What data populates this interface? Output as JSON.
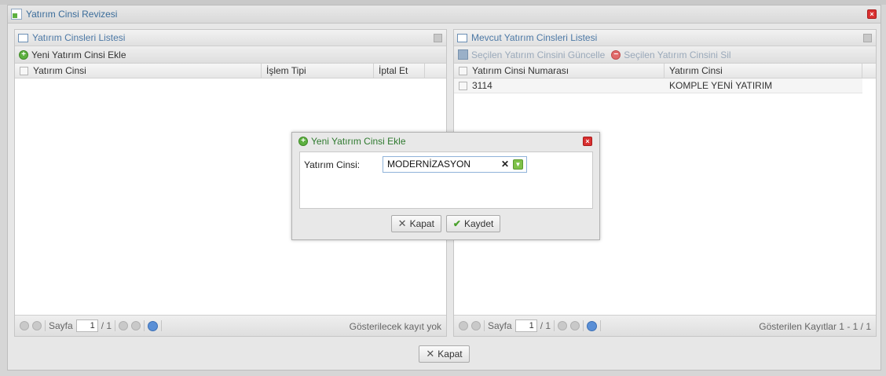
{
  "window": {
    "title": "Yatırım Cinsi Revizesi",
    "close_label": "×",
    "close_button": "Kapat"
  },
  "left_panel": {
    "title": "Yatırım Cinsleri Listesi",
    "add_label": "Yeni Yatırım Cinsi Ekle",
    "columns": [
      "Yatırım Cinsi",
      "İşlem Tipi",
      "İptal Et"
    ],
    "pager": {
      "label": "Sayfa",
      "page": "1",
      "total": "/ 1",
      "info": "Gösterilecek kayıt yok"
    }
  },
  "right_panel": {
    "title": "Mevcut Yatırım Cinsleri Listesi",
    "update_label": "Seçilen Yatırım Cinsini Güncelle",
    "delete_label": "Seçilen Yatırım Cinsini Sil",
    "columns": [
      "Yatırım Cinsi Numarası",
      "Yatırım Cinsi"
    ],
    "rows": [
      {
        "number": "3114",
        "name": "KOMPLE YENİ YATIRIM"
      }
    ],
    "pager": {
      "label": "Sayfa",
      "page": "1",
      "total": "/ 1",
      "info": "Gösterilen Kayıtlar 1 - 1 / 1"
    }
  },
  "dialog": {
    "title": "Yeni Yatırım Cinsi Ekle",
    "field_label": "Yatırım Cinsi:",
    "field_value": "MODERNİZASYON",
    "cancel_label": "Kapat",
    "save_label": "Kaydet"
  },
  "colors": {
    "accent": "#4d79a6",
    "dialog_title": "#2f7a2f",
    "close": "#d93030"
  }
}
